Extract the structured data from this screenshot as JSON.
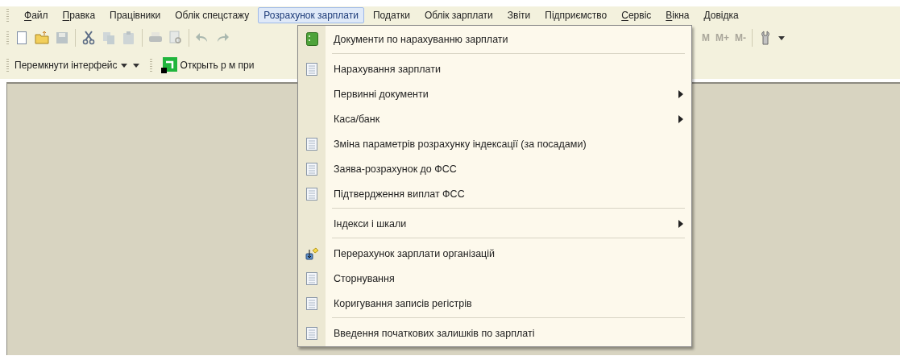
{
  "menu_bar": [
    {
      "label": "Файл",
      "mnemonic": true,
      "selected": false
    },
    {
      "label": "Правка",
      "mnemonic": true,
      "selected": false
    },
    {
      "label": "Працівники",
      "mnemonic": false,
      "selected": false
    },
    {
      "label": "Облік спецстажу",
      "mnemonic": false,
      "selected": false
    },
    {
      "label": "Розрахунок зарплати",
      "mnemonic": false,
      "selected": true
    },
    {
      "label": "Податки",
      "mnemonic": false,
      "selected": false
    },
    {
      "label": "Облік зарплати",
      "mnemonic": false,
      "selected": false
    },
    {
      "label": "Звіти",
      "mnemonic": false,
      "selected": false
    },
    {
      "label": "Підприємство",
      "mnemonic": false,
      "selected": false
    },
    {
      "label": "Сервіс",
      "mnemonic": true,
      "selected": false
    },
    {
      "label": "Вікна",
      "mnemonic": true,
      "selected": false
    },
    {
      "label": "Довідка",
      "mnemonic": false,
      "selected": false
    }
  ],
  "toolbar": {
    "memory_buttons": [
      "M",
      "M+",
      "M-"
    ]
  },
  "toolbar_2": {
    "interface_button": "Перемкнути інтерфейс",
    "open_button": "Открыть р м при"
  },
  "dropdown_menu": {
    "items": [
      {
        "kind": "journal",
        "label": "Документи по нарахуванню зарплати",
        "submenu": false
      },
      {
        "kind": "separator"
      },
      {
        "kind": "document",
        "label": "Нарахування зарплати",
        "submenu": false
      },
      {
        "kind": "plain",
        "label": "Первинні документи",
        "submenu": true
      },
      {
        "kind": "plain",
        "label": "Каса/банк",
        "submenu": true
      },
      {
        "kind": "document",
        "label": "Зміна параметрів розрахунку індексації (за посадами)",
        "submenu": false
      },
      {
        "kind": "document",
        "label": "Заява-розрахунок до ФСС",
        "submenu": false
      },
      {
        "kind": "document",
        "label": "Підтвердження виплат ФСС",
        "submenu": false
      },
      {
        "kind": "separator"
      },
      {
        "kind": "plain",
        "label": "Індекси і шкали",
        "submenu": true
      },
      {
        "kind": "separator"
      },
      {
        "kind": "processing",
        "label": "Перерахунок зарплати організацій",
        "submenu": false
      },
      {
        "kind": "document",
        "label": "Сторнування",
        "submenu": false
      },
      {
        "kind": "document",
        "label": "Коригування записів регістрів",
        "submenu": false
      },
      {
        "kind": "separator"
      },
      {
        "kind": "document",
        "label": "Введення початкових залишків по зарплаті",
        "submenu": false
      }
    ]
  }
}
